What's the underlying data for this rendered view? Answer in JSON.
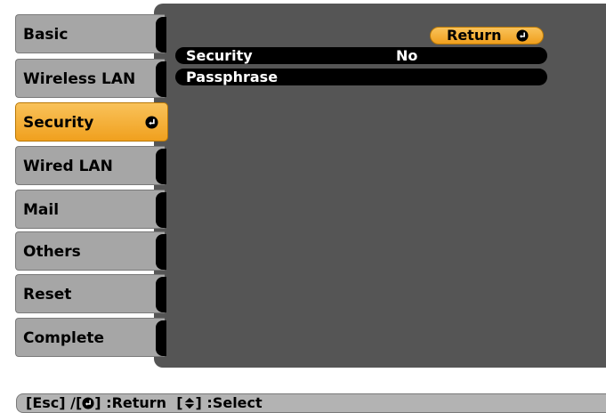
{
  "menu": {
    "items": [
      {
        "label": "Basic"
      },
      {
        "label": "Wireless LAN"
      },
      {
        "label": "Security"
      },
      {
        "label": "Wired LAN"
      },
      {
        "label": "Mail"
      },
      {
        "label": "Others"
      },
      {
        "label": "Reset"
      },
      {
        "label": "Complete"
      }
    ],
    "active_index": 2
  },
  "panel": {
    "return_label": "Return",
    "rows": [
      {
        "label": "Security",
        "value": "No"
      },
      {
        "label": "Passphrase",
        "value": ""
      }
    ]
  },
  "help": {
    "part1": "[Esc] /[",
    "part2": "] :Return  [",
    "part3": "] :Select"
  },
  "colors": {
    "accent": "#f0a01e",
    "panel": "#555555",
    "tab": "#a6a6a6"
  }
}
